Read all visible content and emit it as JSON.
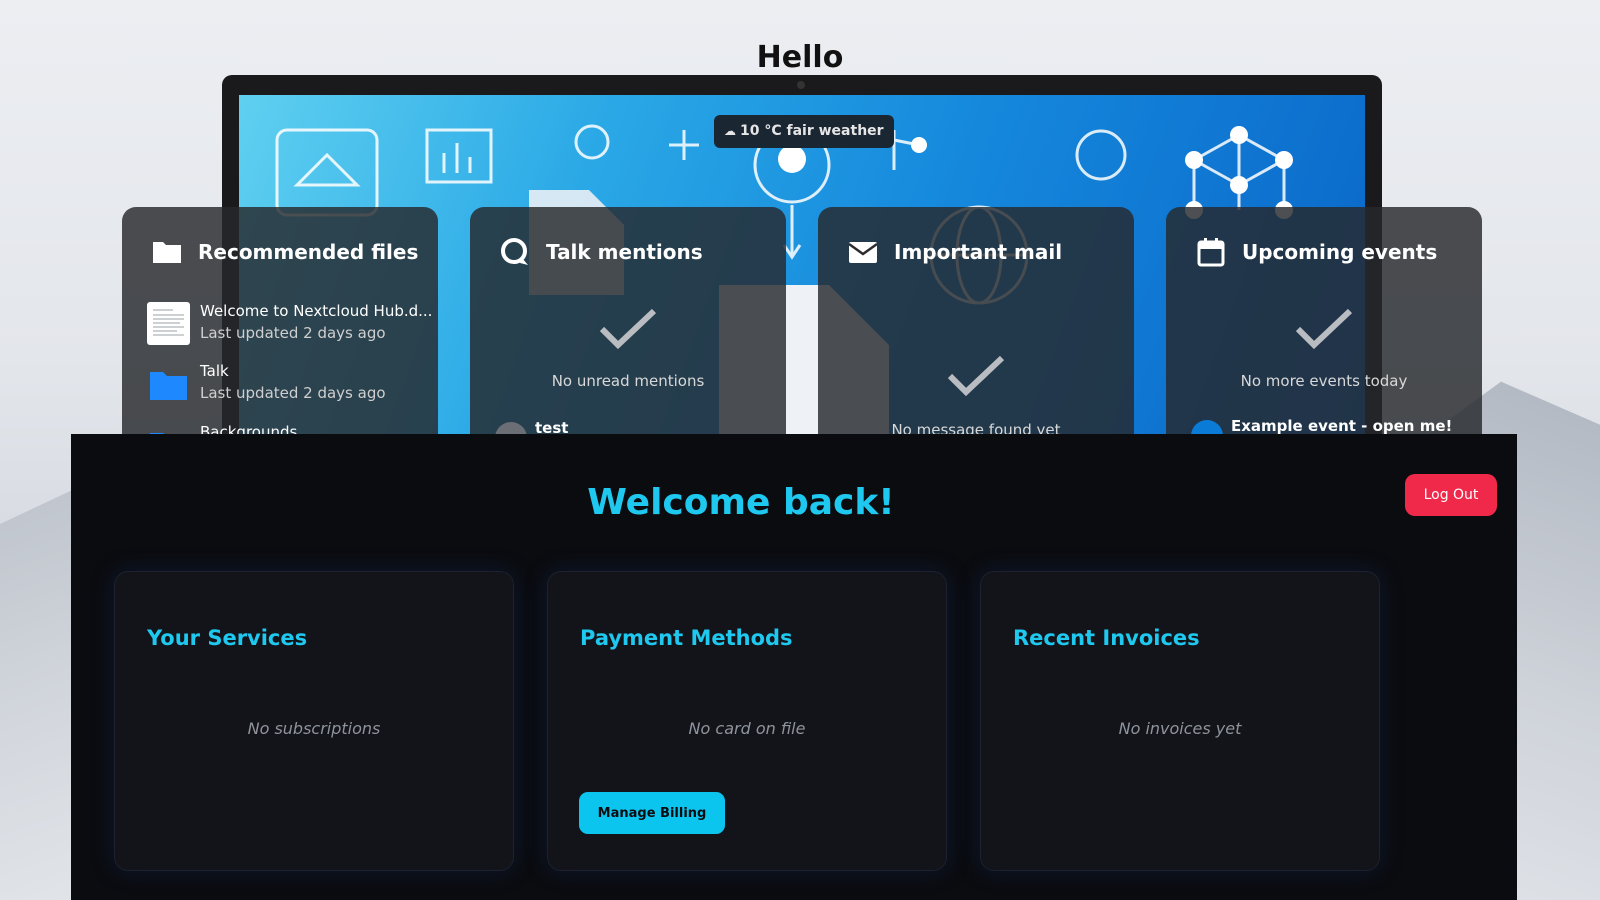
{
  "greeting": "Hello",
  "weather": {
    "text": "10 °C fair weather",
    "icon": "cloud-sun-icon"
  },
  "widgets": {
    "files": {
      "title": "Recommended files",
      "items": [
        {
          "name": "Welcome to Nextcloud Hub.d...",
          "updated": "Last updated 2 days ago",
          "icon": "document-thumbnail"
        },
        {
          "name": "Talk",
          "updated": "Last updated 2 days ago",
          "icon": "folder-icon"
        },
        {
          "name": "Backgrounds",
          "icon": "folder-icon"
        }
      ]
    },
    "talk": {
      "title": "Talk mentions",
      "empty": "No unread mentions",
      "item": "test"
    },
    "mail": {
      "title": "Important mail",
      "empty": "No message found yet"
    },
    "events": {
      "title": "Upcoming events",
      "empty": "No more events today",
      "item": "Example event - open me!"
    }
  },
  "portal": {
    "welcome": "Welcome back!",
    "logout": "Log Out",
    "cards": [
      {
        "title": "Your Services",
        "empty": "No subscriptions"
      },
      {
        "title": "Payment Methods",
        "empty": "No card on file",
        "button": "Manage Billing"
      },
      {
        "title": "Recent Invoices",
        "empty": "No invoices yet"
      }
    ]
  },
  "colors": {
    "accent": "#1fc8ef",
    "logout": "#f0284a",
    "portal_bg": "#0b0c10",
    "card_bg": "#12141a"
  }
}
